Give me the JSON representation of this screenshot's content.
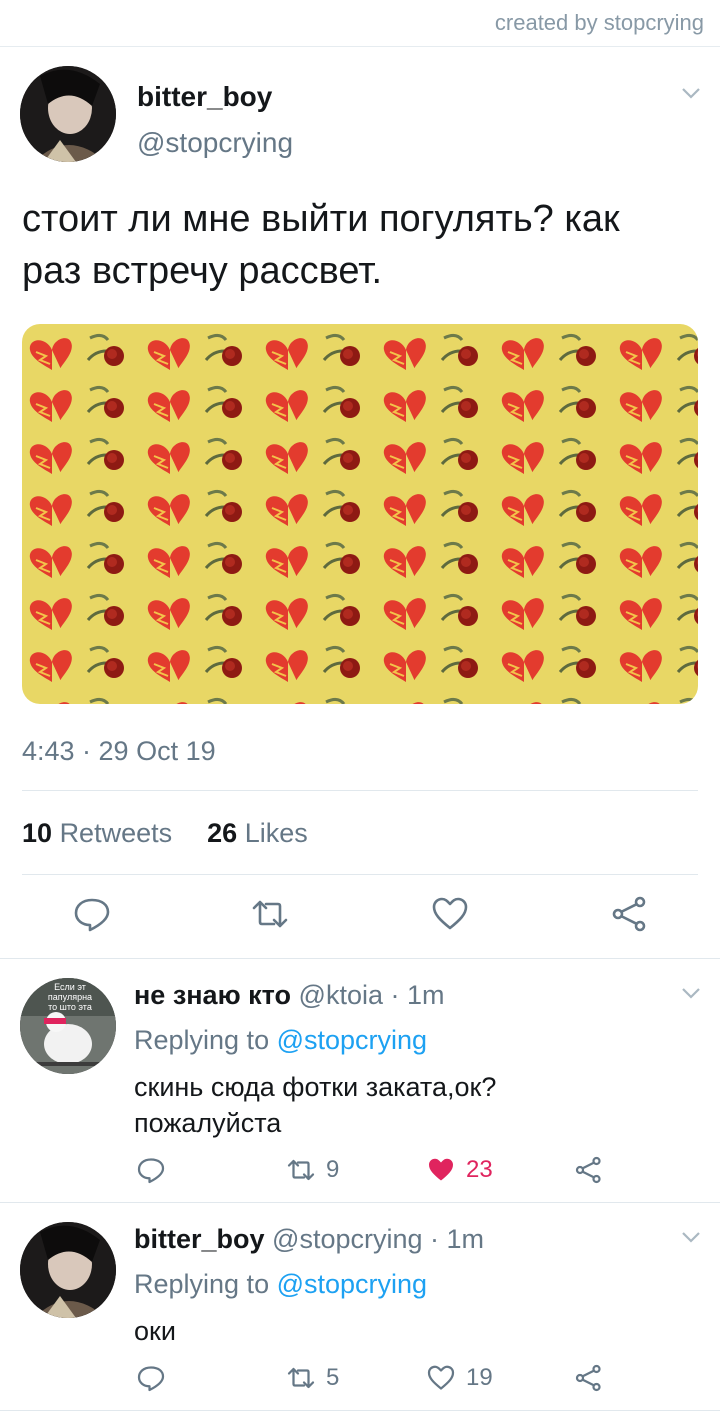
{
  "credit": "created by stopcrying",
  "tweet": {
    "name": "bitter_boy",
    "handle": "@stopcrying",
    "text_line1": "стоит ли мне выйти погулять? как",
    "text_line2": "раз встречу рассвет.",
    "media_bg": "#e8d765",
    "time": "4:43 · 29 Oct 19",
    "retweets_count": "10",
    "retweets_label": "Retweets",
    "likes_count": "26",
    "likes_label": "Likes"
  },
  "replies": [
    {
      "name": "не знаю кто",
      "handle": "@ktoia",
      "time": "· 1m",
      "replying_prefix": "Replying to",
      "replying_to": "@stopcrying",
      "text_line1": "скинь сюда фотки заката,ок?",
      "text_line2": "пожалуйста",
      "avatar_caption": [
        "Если эт",
        "папулярна",
        "то што эта"
      ],
      "retweets": "9",
      "likes": "23",
      "liked": true
    },
    {
      "name": "bitter_boy",
      "handle": "@stopcrying",
      "time": "· 1m",
      "replying_prefix": "Replying to",
      "replying_to": "@stopcrying",
      "text_line1": "оки",
      "retweets": "5",
      "likes": "19",
      "liked": false
    }
  ],
  "colors": {
    "accent": "#1da1f2",
    "like": "#e0245e",
    "muted": "#657786"
  }
}
